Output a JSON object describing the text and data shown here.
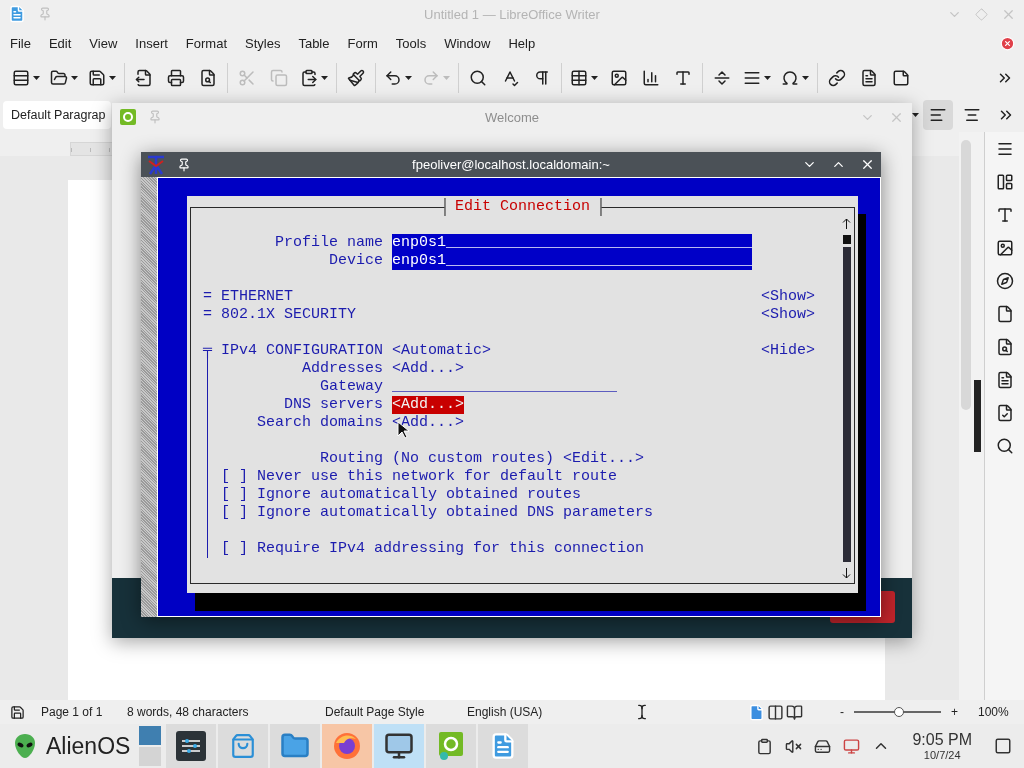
{
  "writer": {
    "title": "Untitled 1 — LibreOffice Writer",
    "menu": [
      "File",
      "Edit",
      "View",
      "Insert",
      "Format",
      "Styles",
      "Table",
      "Form",
      "Tools",
      "Window",
      "Help"
    ],
    "toolbar": [
      [
        {
          "kind": "styles",
          "disabled": false
        },
        {
          "kind": "open",
          "disabled": false
        },
        {
          "kind": "save",
          "disabled": false
        }
      ],
      [
        {
          "kind": "export",
          "disabled": false
        },
        {
          "kind": "print",
          "disabled": false
        },
        {
          "kind": "preview",
          "disabled": false
        }
      ],
      [
        {
          "kind": "cut",
          "disabled": true
        },
        {
          "kind": "copy",
          "disabled": true
        },
        {
          "kind": "paste",
          "disabled": false
        }
      ],
      [
        {
          "kind": "clone",
          "disabled": false
        }
      ],
      [
        {
          "kind": "undo",
          "disabled": false
        },
        {
          "kind": "redo",
          "disabled": true
        }
      ],
      [
        {
          "kind": "find",
          "disabled": false
        },
        {
          "kind": "spelling",
          "disabled": false
        },
        {
          "kind": "marks",
          "disabled": false
        }
      ],
      [
        {
          "kind": "table",
          "disabled": false
        },
        {
          "kind": "image",
          "disabled": false
        },
        {
          "kind": "chart",
          "disabled": false
        },
        {
          "kind": "textbox",
          "disabled": false
        }
      ],
      [
        {
          "kind": "pagebreak",
          "disabled": false
        },
        {
          "kind": "field",
          "disabled": false
        },
        {
          "kind": "special",
          "disabled": false
        }
      ],
      [
        {
          "kind": "link",
          "disabled": false
        },
        {
          "kind": "footnote",
          "disabled": false
        },
        {
          "kind": "comment",
          "disabled": false
        }
      ]
    ],
    "paragraph_style": "Default Paragrap",
    "alignment": [
      {
        "selected": true
      },
      {
        "selected": false
      }
    ],
    "status_bar": {
      "page": "Page 1 of 1",
      "words": "8 words, 48 characters",
      "page_style": "Default Page Style",
      "language": "English (USA)",
      "views": [
        {
          "selected": true
        },
        {
          "selected": false
        },
        {
          "selected": false
        }
      ],
      "zoom_out": "-",
      "zoom_slider": {
        "level": 0.52
      },
      "zoom_in": "+",
      "zoom": "100%"
    }
  },
  "welcome": {
    "title": "Welcome"
  },
  "terminal": {
    "title": "fpeoliver@localhost.localdomain:~",
    "dialog": {
      "title": "Edit Connection",
      "groups": [
        [
          {
            "kind": "field",
            "label": "Profile name",
            "value": "enp0s1__________________________________"
          },
          {
            "kind": "field",
            "label": "Device",
            "value": "enp0s1__________________________________"
          }
        ],
        [
          {
            "kind": "section",
            "marker": "=",
            "label": "ETHERNET",
            "toggle": "<Show>"
          },
          {
            "kind": "section",
            "marker": "=",
            "label": "802.1X SECURITY",
            "toggle": "<Show>"
          }
        ],
        [
          {
            "kind": "section",
            "marker": "╤",
            "label": "IPv4 CONFIGURATION",
            "value": "<Automatic>",
            "toggle": "<Hide>",
            "children": [
              [
                {
                  "kind": "button",
                  "label": "Addresses",
                  "value": "<Add...>",
                  "selected": false
                },
                {
                  "kind": "input",
                  "label": "Gateway",
                  "value": "_________________________"
                },
                {
                  "kind": "button",
                  "label": "DNS servers",
                  "value": "<Add...>",
                  "selected": true
                },
                {
                  "kind": "button",
                  "label": "Search domains",
                  "value": "<Add...>",
                  "selected": false
                }
              ],
              [
                {
                  "kind": "button",
                  "label": "Routing",
                  "note": "(No custom routes)",
                  "value": "<Edit...>",
                  "selected": false
                },
                {
                  "kind": "checkbox",
                  "box": "[ ]",
                  "label": "Never use this network for default route",
                  "checked": false
                },
                {
                  "kind": "checkbox",
                  "box": "[ ]",
                  "label": "Ignore automatically obtained routes",
                  "checked": false
                },
                {
                  "kind": "checkbox",
                  "box": "[ ]",
                  "label": "Ignore automatically obtained DNS parameters",
                  "checked": false
                }
              ],
              [
                {
                  "kind": "checkbox",
                  "box": "[ ]",
                  "label": "Require IPv4 addressing for this connection",
                  "checked": false
                }
              ]
            ]
          }
        ]
      ]
    }
  },
  "taskbar": {
    "launcher": "AlienOS",
    "apps": [
      {
        "kind": "settings",
        "color": "#dcdcdc"
      },
      {
        "kind": "store",
        "color": "#dcdcdc"
      },
      {
        "kind": "files",
        "color": "#dcdcdc"
      },
      {
        "kind": "browser",
        "color": "#f7c6a6"
      },
      {
        "kind": "computer",
        "color": "#bfe0f6"
      },
      {
        "kind": "welcome",
        "color": "#dcdcdc"
      },
      {
        "kind": "writer",
        "color": "#dcdcdc"
      }
    ],
    "time": "9:05 PM",
    "date": "10/7/24"
  }
}
